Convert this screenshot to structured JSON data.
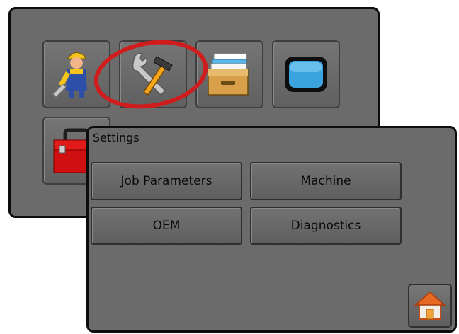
{
  "launcher": {
    "icons": [
      {
        "icon": "operator-worker-icon"
      },
      {
        "icon": "wrench-hammer-tools-icon"
      },
      {
        "icon": "file-drawer-icon"
      },
      {
        "icon": "blue-screen-icon"
      },
      {
        "icon": "red-toolbox-icon"
      }
    ],
    "highlight_color": "#d01c1c"
  },
  "settings": {
    "title": "Settings",
    "buttons": {
      "job_parameters": "Job Parameters",
      "machine": "Machine",
      "oem": "OEM",
      "diagnostics": "Diagnostics"
    },
    "home_icon": "home-icon"
  },
  "colors": {
    "panel_bg": "#6b6b6b",
    "panel_border": "#0d0d0d",
    "text": "#0a0a0a"
  }
}
